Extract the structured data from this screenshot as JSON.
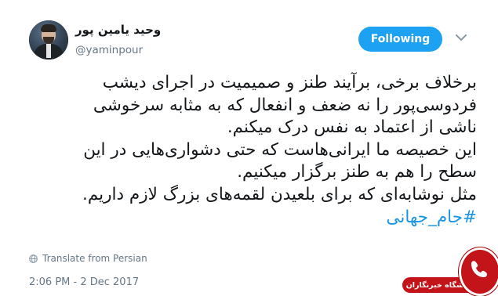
{
  "user": {
    "display_name": "وحید یامین پور",
    "handle": "@yaminpour"
  },
  "follow_button": {
    "label": "Following",
    "color": "#1da1f2"
  },
  "tweet": {
    "lines": [
      "برخلاف برخی، برآیند طنز و صمیمیت در اجرای دیشب",
      "فردوسی‌پور را نه ضعف و انفعال که به مثابه سرخوشی",
      "ناشی از اعتماد به نفس درک میکنم.",
      "این خصیصه ما ایرانی‌هاست که حتی دشواری‌هایی در این",
      "سطح را هم به طنز برگزار میکنیم.",
      "مثل نوشابه‌ای که برای بلعیدن لقمه‌های بزرگ لازم داریم."
    ],
    "hashtag": "#جام_جهانی",
    "hashtag_color": "#1b95e0"
  },
  "translate": {
    "label": "Translate from Persian",
    "icon": "globe-icon"
  },
  "timestamp": "2:06 PM - 2 Dec 2017",
  "watermark": {
    "label": "باشگاه خبرنگاران",
    "color": "#c3141a"
  }
}
